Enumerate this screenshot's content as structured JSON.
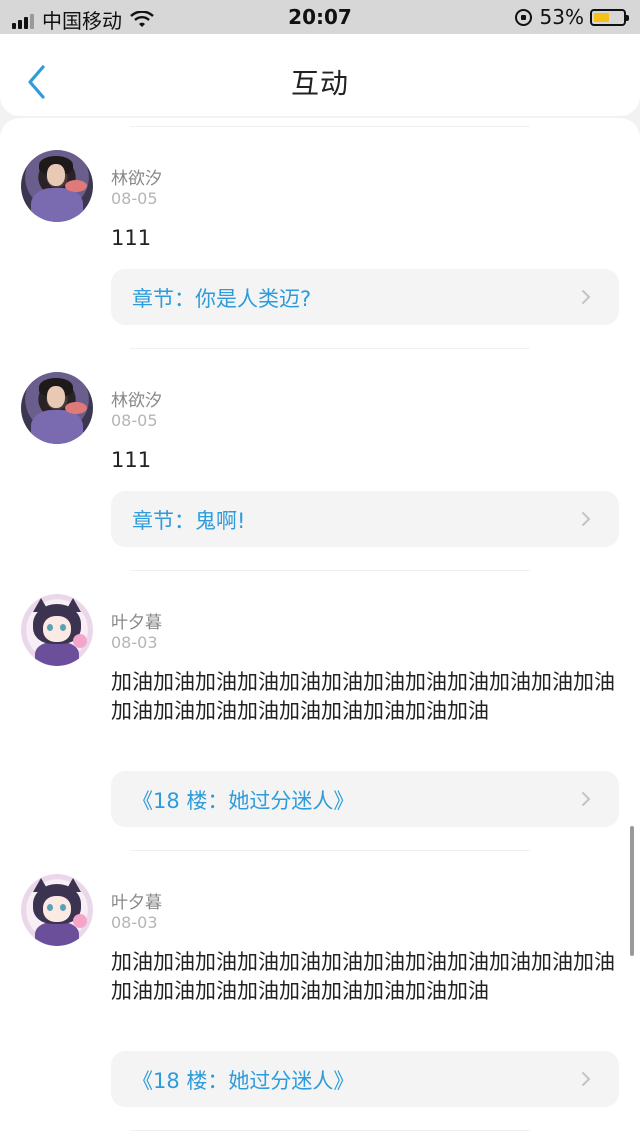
{
  "status_bar": {
    "carrier": "中国移动",
    "time": "20:07",
    "battery_percent": "53%",
    "battery_level": 0.53,
    "icons": [
      "signal-icon",
      "wifi-icon",
      "rotation-lock-icon",
      "battery-icon"
    ]
  },
  "header": {
    "title": "互动",
    "back_icon": "chevron-left-icon"
  },
  "posts": [
    {
      "username": "林欲汐",
      "date": "08-05",
      "text": "111",
      "chapter": "章节：你是人类迈?",
      "avatar": "user-avatar-a"
    },
    {
      "username": "林欲汐",
      "date": "08-05",
      "text": "111",
      "chapter": "章节：鬼啊!",
      "avatar": "user-avatar-a"
    },
    {
      "username": "叶夕暮",
      "date": "08-03",
      "text": "加油加油加油加油加油加油加油加油加油加油加油加油加油加油加油加油加油加油加油加油加油",
      "chapter": "《18 楼：她过分迷人》",
      "avatar": "user-avatar-b"
    },
    {
      "username": "叶夕暮",
      "date": "08-03",
      "text": "加油加油加油加油加油加油加油加油加油加油加油加油加油加油加油加油加油加油加油加油加油",
      "chapter": "《18 楼：她过分迷人》",
      "avatar": "user-avatar-b"
    }
  ],
  "colors": {
    "accent": "#2e9cdb",
    "background": "#f2f2f2",
    "card": "#f4f4f4",
    "battery": "#f4c218"
  }
}
